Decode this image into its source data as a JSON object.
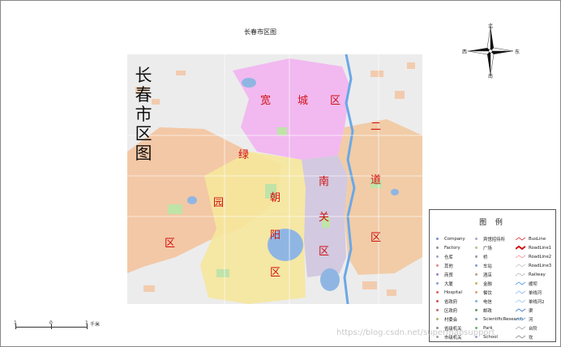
{
  "map": {
    "title": "长春市区图",
    "vertical_title": [
      "长",
      "春",
      "市",
      "区",
      "图"
    ],
    "districts": [
      {
        "name": "宽城区",
        "chars": [
          "宽",
          "城",
          "区"
        ]
      },
      {
        "name": "二道区",
        "chars": [
          "二",
          "道",
          "区"
        ]
      },
      {
        "name": "南关区",
        "chars": [
          "南",
          "关",
          "区"
        ]
      },
      {
        "name": "朝阳区",
        "chars": [
          "朝",
          "阳",
          "区"
        ]
      },
      {
        "name": "绿园区",
        "chars": [
          "绿",
          "园",
          "区"
        ]
      }
    ],
    "district_colors": {
      "kuancheng": "#f1b6f0",
      "erdao": "#f2c9a0",
      "nanguan": "#d2c7df",
      "chaoyang": "#f6e79c",
      "lvyuan": "#f4c49f",
      "water": "#8fb6e3",
      "green": "#bfe3a8",
      "base": "#ececec"
    }
  },
  "compass": {
    "north": "北",
    "south": "南",
    "east": "东",
    "west": "西"
  },
  "scale_bar": {
    "ticks": [
      "1",
      "0",
      "1"
    ],
    "unit": "千米"
  },
  "legend": {
    "title": "图  例",
    "col1": [
      {
        "label": "Company",
        "color": "#7c8fbf"
      },
      {
        "label": "Factory",
        "color": "#8f8f8f"
      },
      {
        "label": "仓库",
        "color": "#9aa8c8"
      },
      {
        "label": "其他",
        "color": "#e08a8a"
      },
      {
        "label": "商贸",
        "color": "#a07fc0"
      },
      {
        "label": "大厦",
        "color": "#8aa0c8"
      },
      {
        "label": "Hospital",
        "color": "#e06060"
      },
      {
        "label": "省政府",
        "color": "#d05050"
      },
      {
        "label": "区政府",
        "color": "#c06c6c"
      },
      {
        "label": "村委会",
        "color": "#b0b080"
      },
      {
        "label": "省级机关",
        "color": "#909090"
      },
      {
        "label": "市级机关",
        "color": "#a0a0a0"
      }
    ],
    "col2": [
      {
        "label": "宾馆招待所",
        "color": "#b0a0d0"
      },
      {
        "label": "广场",
        "color": "#a8c890"
      },
      {
        "label": "桥",
        "color": "#9a9a9a"
      },
      {
        "label": "车站",
        "color": "#7f9fd0"
      },
      {
        "label": "酒店",
        "color": "#c0a080"
      },
      {
        "label": "金融",
        "color": "#d0b060"
      },
      {
        "label": "餐饮",
        "color": "#e0a070"
      },
      {
        "label": "电信",
        "color": "#80b0d0"
      },
      {
        "label": "邮政",
        "color": "#60a060"
      },
      {
        "label": "ScientificResearch",
        "color": "#8fa0b0"
      },
      {
        "label": "Park",
        "color": "#70b070"
      },
      {
        "label": "School",
        "color": "#a0a0d0"
      }
    ],
    "col3": [
      {
        "label": "BusLine",
        "color": "#e04040",
        "style": "thin"
      },
      {
        "label": "RoadLine1",
        "color": "#d01010",
        "style": "thick"
      },
      {
        "label": "RoadLine2",
        "color": "#f0a0a0",
        "style": "thin"
      },
      {
        "label": "RoadLine3",
        "color": "#c8c8c8",
        "style": "thin"
      },
      {
        "label": "Railway",
        "color": "#a0a0a0",
        "style": "dash"
      },
      {
        "label": "缓坝",
        "color": "#5a9be0",
        "style": "thin"
      },
      {
        "label": "单线河",
        "color": "#8fc0ef",
        "style": "thin"
      },
      {
        "label": "单线河2",
        "color": "#a8cdf2",
        "style": "thin"
      },
      {
        "label": "渠",
        "color": "#4a7fd0",
        "style": "thin"
      },
      {
        "label": "河",
        "color": "#6aa8e8",
        "style": "thin"
      },
      {
        "label": "台阶",
        "color": "#b0b0b0",
        "style": "thin"
      },
      {
        "label": "坎",
        "color": "#909090",
        "style": "thin"
      }
    ]
  },
  "watermark": "https://blog.csdn.net/supermapsupport"
}
